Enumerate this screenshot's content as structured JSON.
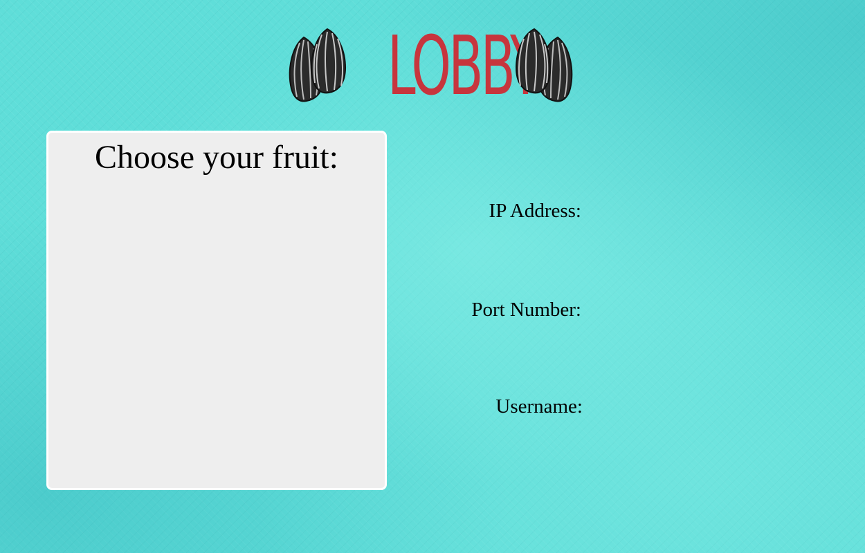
{
  "header": {
    "title": "LOBBY",
    "decoration_icon": "sunflower-seeds-icon",
    "title_color": "#c7353d"
  },
  "fruit_panel": {
    "heading": "Choose your fruit:",
    "options": []
  },
  "connection_form": {
    "ip_address": {
      "label": "IP Address:",
      "value": ""
    },
    "port_number": {
      "label": "Port Number:",
      "value": ""
    },
    "username": {
      "label": "Username:",
      "value": ""
    }
  },
  "colors": {
    "background": "#5fded9",
    "panel": "#eeeeee",
    "panel_border": "#ffffff",
    "seed": "#2a2a2a"
  }
}
